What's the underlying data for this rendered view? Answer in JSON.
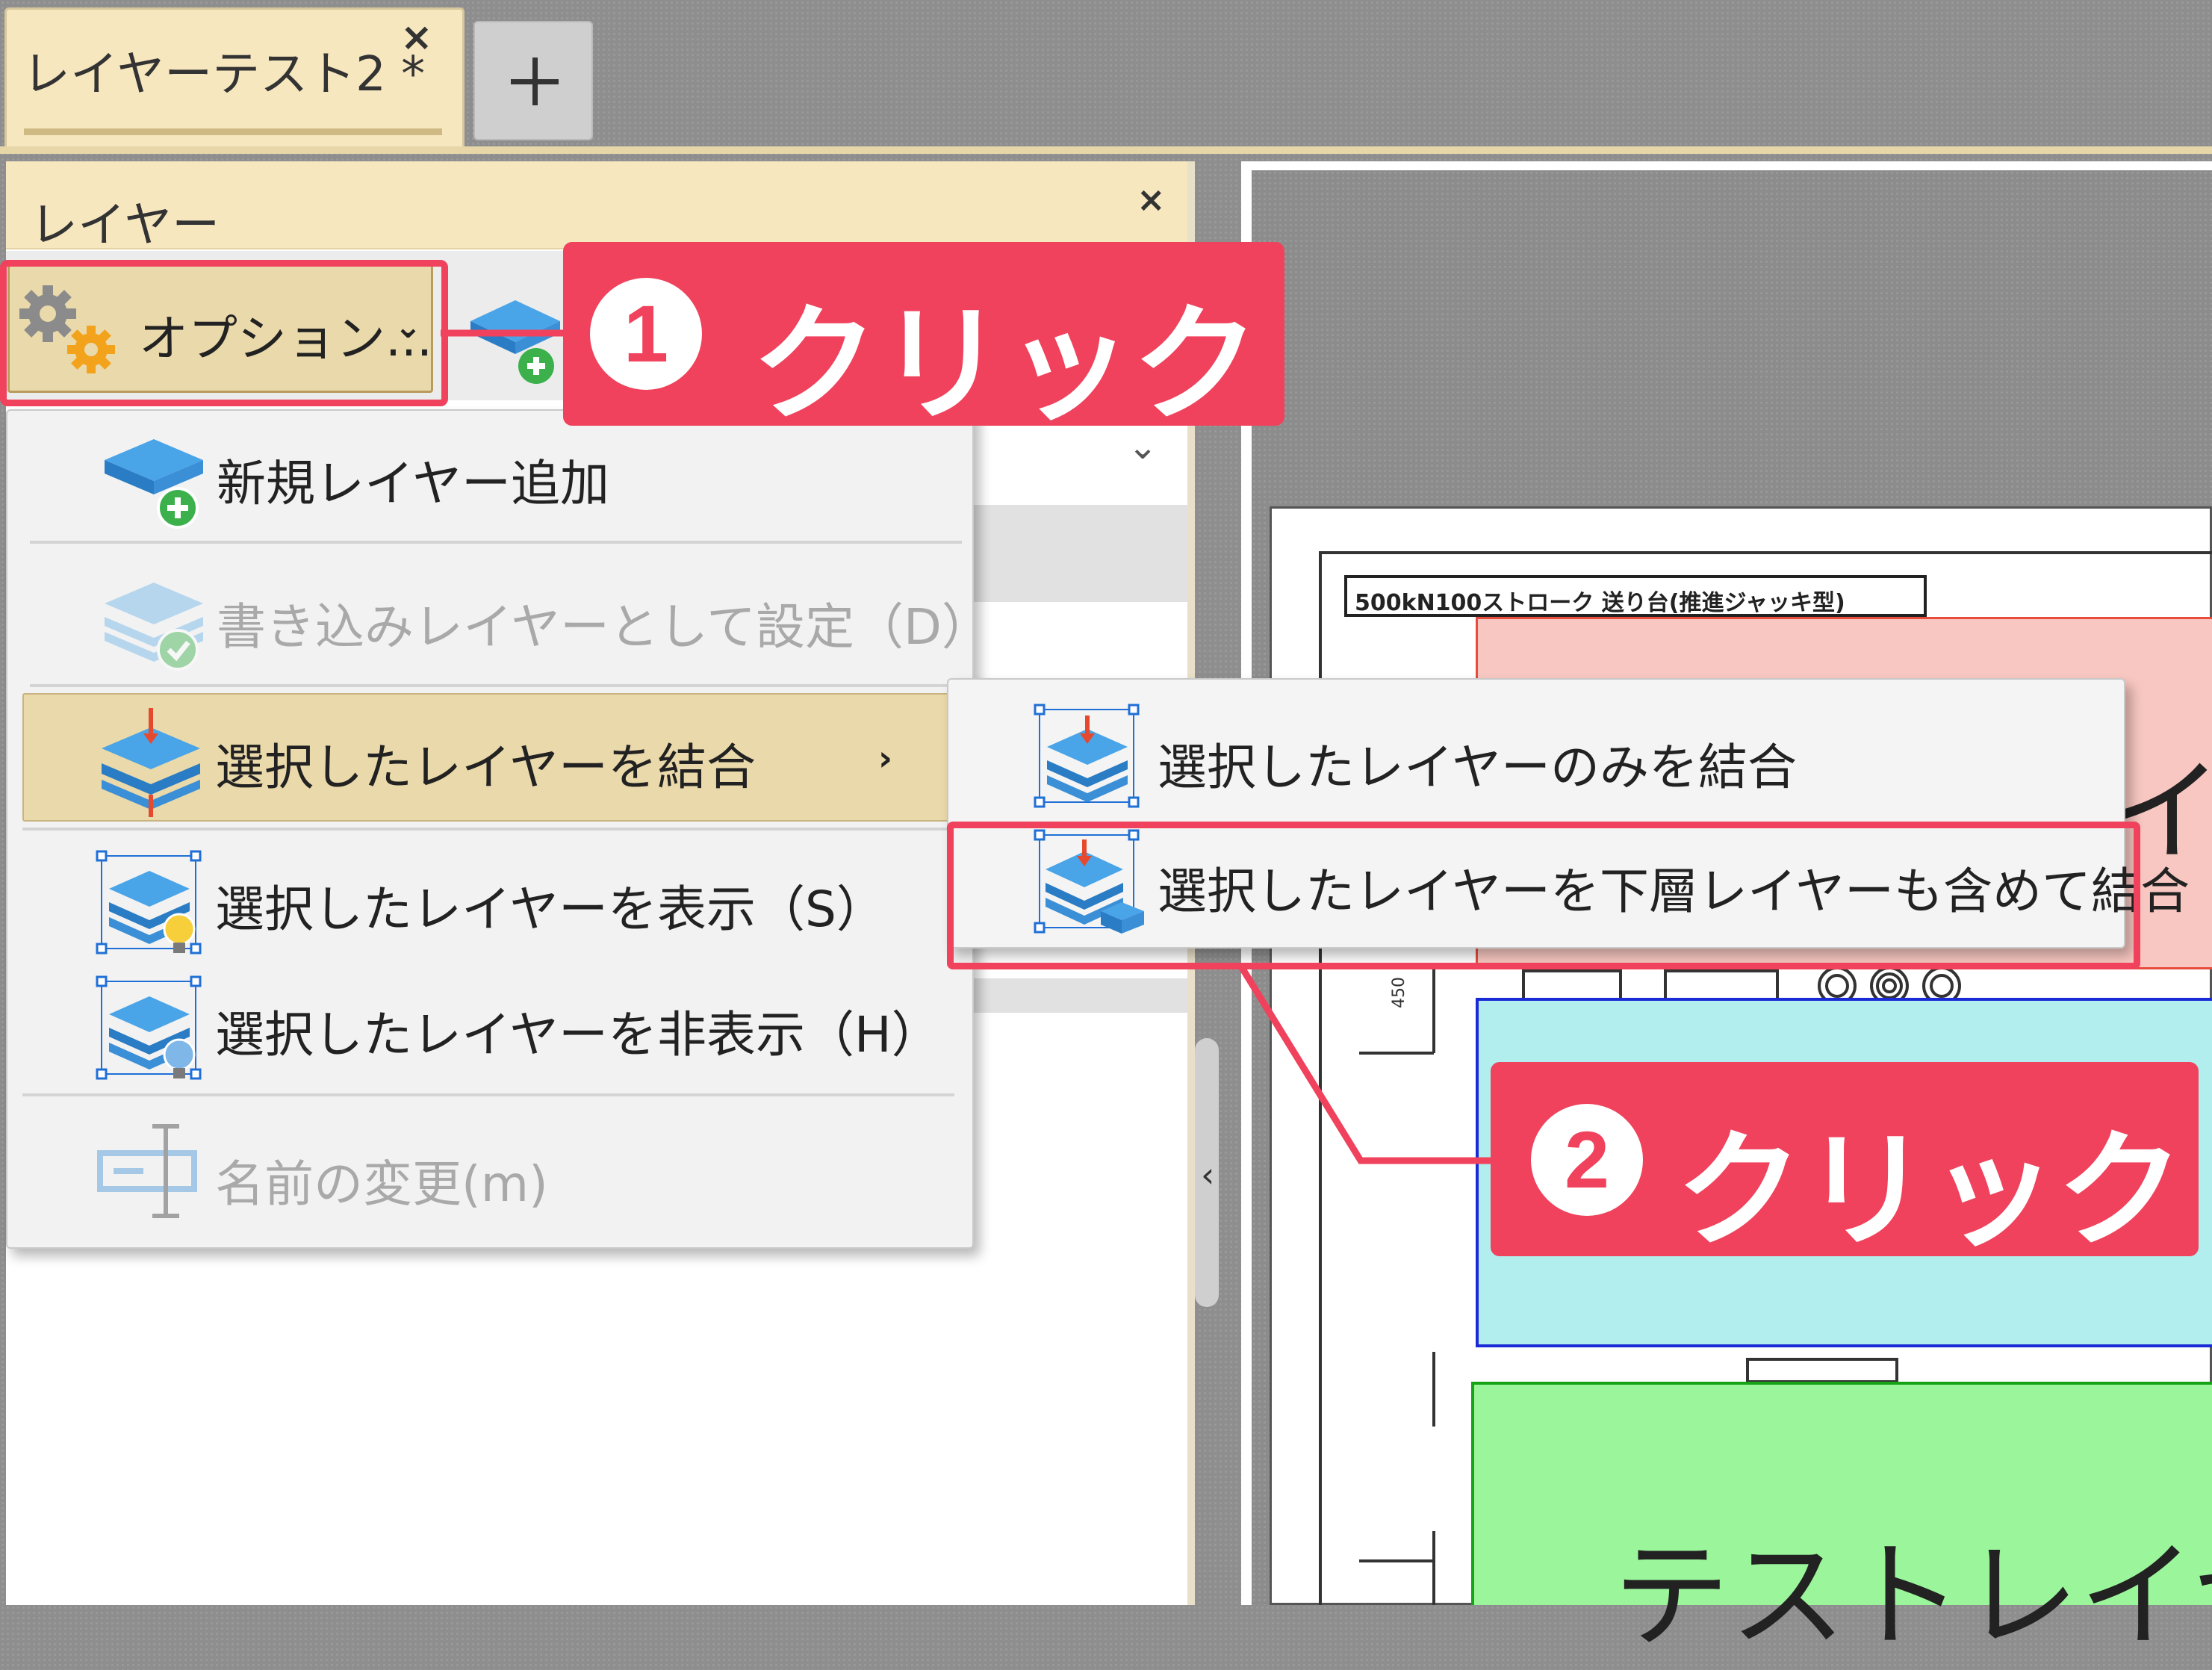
{
  "tab": {
    "title": "レイヤーテスト2 *",
    "close": "×",
    "new_tab": "+"
  },
  "panel": {
    "title": "レイヤー",
    "close": "×",
    "options_label": "オプション...",
    "options_chevron": "⌄",
    "filter_chevron": "⌄",
    "splitter_arrow": "‹"
  },
  "menu": {
    "items": [
      {
        "label": "新規レイヤー追加",
        "icon": "add-layer-icon",
        "enabled": true
      },
      {
        "label": "書き込みレイヤーとして設定（D）",
        "icon": "set-write-layer-icon",
        "enabled": false
      },
      {
        "label": "選択したレイヤーを結合",
        "icon": "merge-layers-icon",
        "enabled": true,
        "submenu": "›"
      },
      {
        "label": "選択したレイヤーを表示（S）",
        "icon": "show-layer-icon",
        "enabled": true
      },
      {
        "label": "選択したレイヤーを非表示（H）",
        "icon": "hide-layer-icon",
        "enabled": true
      },
      {
        "label": "名前の変更(m)",
        "icon": "rename-icon",
        "enabled": false
      }
    ]
  },
  "submenu": {
    "items": [
      {
        "label": "選択したレイヤーのみを結合",
        "icon": "merge-selected-only-icon"
      },
      {
        "label": "選択したレイヤーを下層レイヤーも含めて結合",
        "icon": "merge-including-lower-icon"
      }
    ]
  },
  "callouts": [
    {
      "number": "1",
      "text": "クリック"
    },
    {
      "number": "2",
      "text": "クリック"
    }
  ],
  "document": {
    "title": "500kN100ストローク 送り台(推進ジャッキ型)",
    "red_layer_text": "イ",
    "green_layer_text": "テストレイヤ"
  },
  "colors": {
    "highlight": "#f0425c",
    "panel_header": "#f6e7bf",
    "menu_selected": "#ead9aa",
    "layer_red": "#f8c7c1",
    "layer_cyan": "#b2eeee",
    "layer_green": "#9bf59b"
  }
}
